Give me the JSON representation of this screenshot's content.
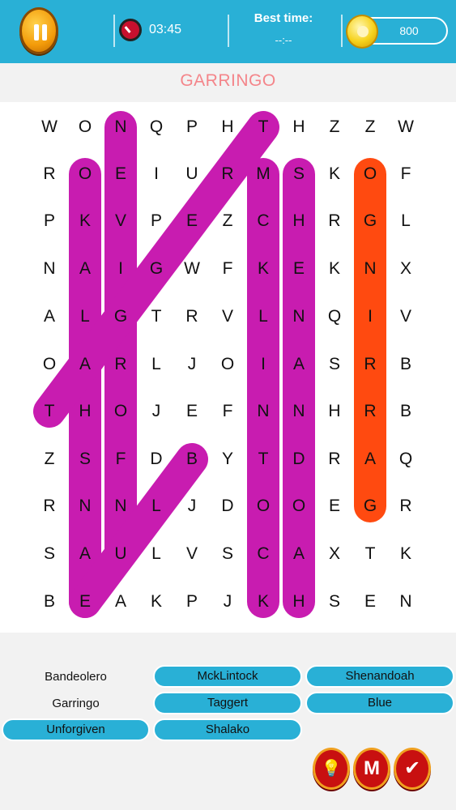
{
  "header": {
    "timer": "03:45",
    "best_time_label": "Best time:",
    "best_time_value": "--:--",
    "coins": "800",
    "icons": [
      "pause-icon",
      "stopwatch-icon",
      "coin-bag-icon"
    ]
  },
  "current_word": "GARRINGO",
  "grid": [
    [
      "W",
      "O",
      "N",
      "Q",
      "P",
      "H",
      "T",
      "H",
      "Z",
      "Z",
      "W"
    ],
    [
      "R",
      "O",
      "E",
      "I",
      "U",
      "R",
      "M",
      "S",
      "K",
      "O",
      "F"
    ],
    [
      "P",
      "K",
      "V",
      "P",
      "E",
      "Z",
      "C",
      "H",
      "R",
      "G",
      "L"
    ],
    [
      "N",
      "A",
      "I",
      "G",
      "W",
      "F",
      "K",
      "E",
      "K",
      "N",
      "X"
    ],
    [
      "A",
      "L",
      "G",
      "T",
      "R",
      "V",
      "L",
      "N",
      "Q",
      "I",
      "V"
    ],
    [
      "O",
      "A",
      "R",
      "L",
      "J",
      "O",
      "I",
      "A",
      "S",
      "R",
      "B"
    ],
    [
      "T",
      "H",
      "O",
      "J",
      "E",
      "F",
      "N",
      "N",
      "H",
      "R",
      "B"
    ],
    [
      "Z",
      "S",
      "F",
      "D",
      "B",
      "Y",
      "T",
      "D",
      "R",
      "A",
      "Q"
    ],
    [
      "R",
      "N",
      "N",
      "L",
      "J",
      "D",
      "O",
      "O",
      "E",
      "G",
      "R"
    ],
    [
      "S",
      "A",
      "U",
      "L",
      "V",
      "S",
      "C",
      "A",
      "X",
      "T",
      "K"
    ],
    [
      "B",
      "E",
      "A",
      "K",
      "P",
      "J",
      "K",
      "H",
      "S",
      "E",
      "N"
    ]
  ],
  "found_paths": [
    {
      "word": "Bandeolero",
      "from": [
        10,
        1
      ],
      "to": [
        1,
        1
      ],
      "color": "#c81cb0"
    },
    {
      "word": "Unforgiven",
      "from": [
        9,
        2
      ],
      "to": [
        0,
        2
      ],
      "color": "#c81cb0"
    },
    {
      "word": "McKLintock",
      "from": [
        1,
        6
      ],
      "to": [
        10,
        6
      ],
      "color": "#c81cb0"
    },
    {
      "word": "Shenandoah",
      "from": [
        1,
        7
      ],
      "to": [
        10,
        7
      ],
      "color": "#c81cb0"
    },
    {
      "word": "Taggert",
      "from": [
        0,
        6
      ],
      "to": [
        6,
        0
      ],
      "color": "#c81cb0"
    },
    {
      "word": "Blue",
      "from": [
        7,
        4
      ],
      "to": [
        10,
        1
      ],
      "color": "#c81cb0"
    },
    {
      "word": "Garringo",
      "from": [
        1,
        9
      ],
      "to": [
        8,
        9
      ],
      "color": "#ff4a10"
    }
  ],
  "word_list": [
    {
      "label": "Bandeolero",
      "found": false
    },
    {
      "label": "MckLintock",
      "found": true
    },
    {
      "label": "Shenandoah",
      "found": true
    },
    {
      "label": "Garringo",
      "found": false
    },
    {
      "label": "Taggert",
      "found": true
    },
    {
      "label": "Blue",
      "found": true
    },
    {
      "label": "Unforgiven",
      "found": true
    },
    {
      "label": "Shalako",
      "found": true
    }
  ],
  "actions": {
    "hint_icon": "lightbulb-icon",
    "m_label": "M",
    "check_icon": "checkmark-icon"
  },
  "colors": {
    "accent": "#29b0d6",
    "highlight": "#c81cb0",
    "current": "#ff4a10",
    "title": "#f4858a"
  }
}
